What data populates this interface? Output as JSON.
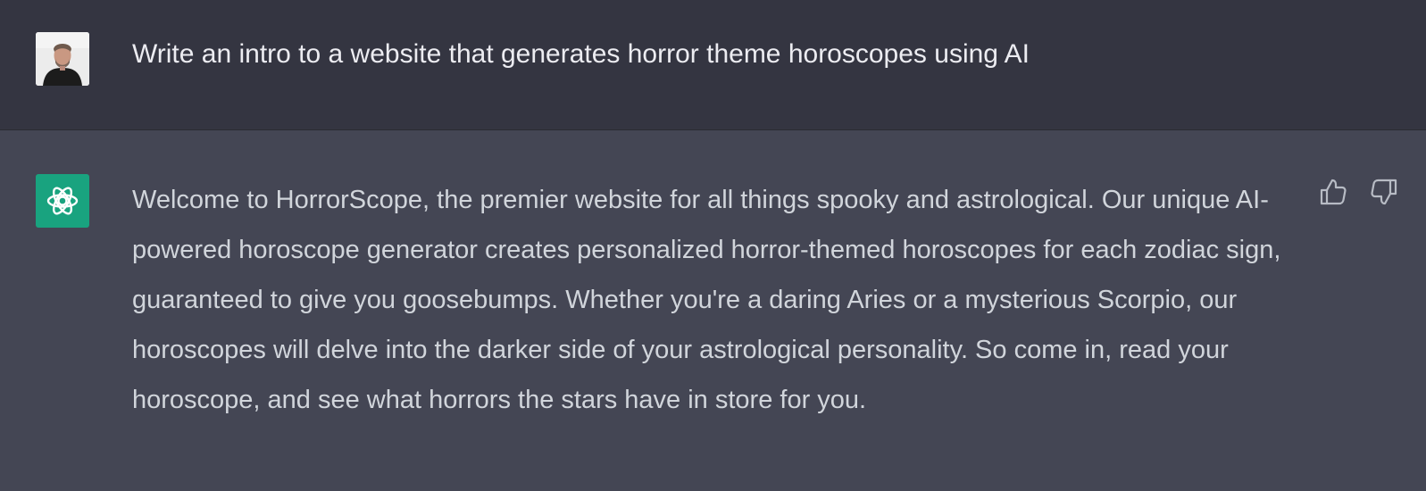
{
  "user_message": {
    "text": "Write an intro to a website that generates horror theme horoscopes using AI"
  },
  "assistant_message": {
    "text": "Welcome to HorrorScope, the premier website for all things spooky and astrological. Our unique AI-powered horoscope generator creates personalized horror-themed horoscopes for each zodiac sign, guaranteed to give you goosebumps. Whether you're a daring Aries or a mysterious Scorpio, our horoscopes will delve into the darker side of your astrological personality. So come in, read your horoscope, and see what horrors the stars have in store for you."
  },
  "icons": {
    "user_avatar": "user-avatar-photo",
    "assistant_logo": "openai-logo",
    "thumbs_up": "thumbs-up-icon",
    "thumbs_down": "thumbs-down-icon"
  },
  "colors": {
    "user_row_background": "#343541",
    "assistant_row_background": "#444654",
    "assistant_logo_background": "#19a37f",
    "text": "#d1d5db",
    "user_text": "#ececf1"
  }
}
